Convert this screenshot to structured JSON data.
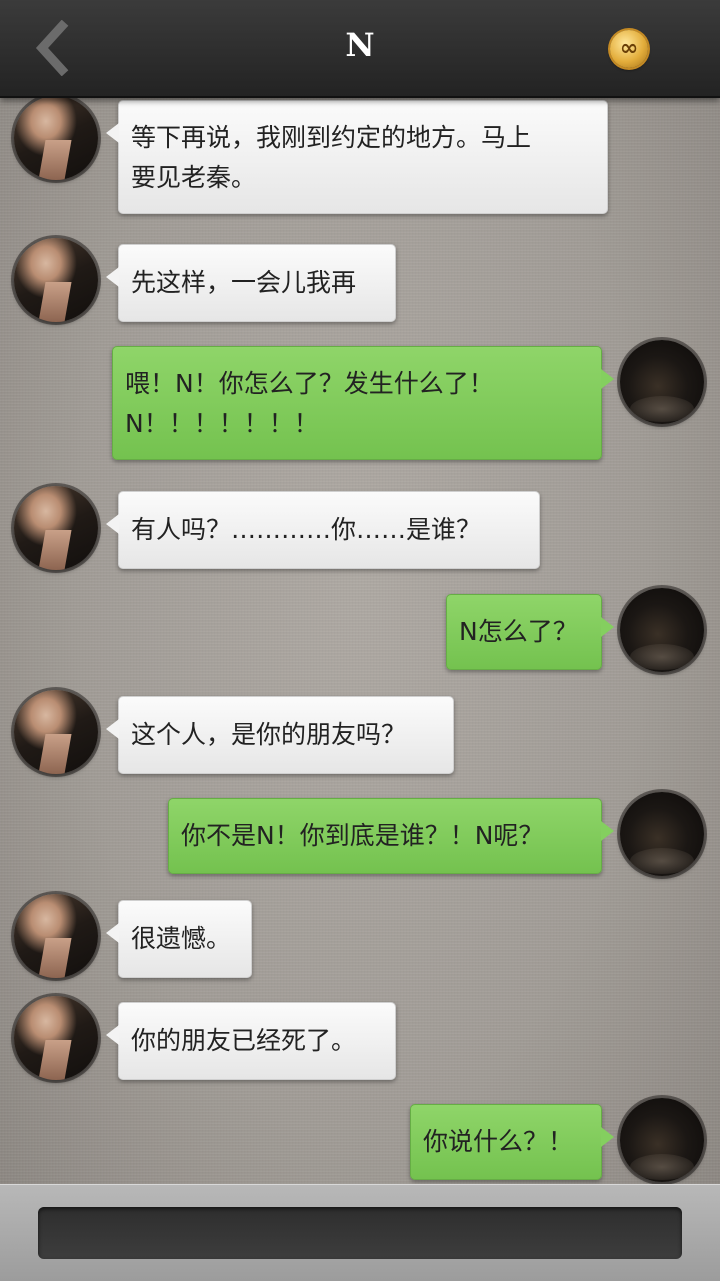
{
  "header": {
    "title": "N",
    "back_icon": "chevron-left-icon",
    "coin_icon": "infinity-coin-icon",
    "coin_symbol": "∞"
  },
  "colors": {
    "header_bg": "#2c2c2c",
    "incoming_bubble": "#f2f2f2",
    "outgoing_bubble": "#82cb5c",
    "input_bg": "#353535"
  },
  "messages": [
    {
      "from": "N",
      "text": "等下再说，我刚到约定的地方。马上\n要见老秦。"
    },
    {
      "from": "N",
      "text": "先这样，一会儿我再"
    },
    {
      "from": "me",
      "text": "喂！N！你怎么了？发生什么了！\nN！！！！！！！"
    },
    {
      "from": "N",
      "text": "有人吗？…………你……是谁？"
    },
    {
      "from": "me",
      "text": "N怎么了？"
    },
    {
      "from": "N",
      "text": "这个人，是你的朋友吗？"
    },
    {
      "from": "me",
      "text": "你不是N！你到底是谁？！N呢？"
    },
    {
      "from": "N",
      "text": "很遗憾。"
    },
    {
      "from": "N",
      "text": "你的朋友已经死了。"
    },
    {
      "from": "me",
      "text": "你说什么？！"
    }
  ],
  "input": {
    "value": "",
    "placeholder": ""
  }
}
